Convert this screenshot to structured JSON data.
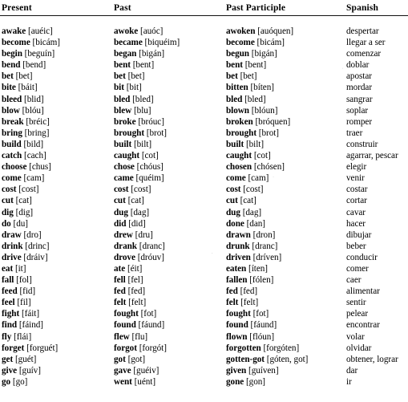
{
  "document": {
    "type": "irregular-verbs-table",
    "headers": {
      "present": "Present",
      "past": "Past",
      "past_participle": "Past Participle",
      "spanish": "Spanish"
    }
  },
  "rows": [
    {
      "present": "awake",
      "present_pron": "[auéic]",
      "past": "awoke",
      "past_pron": "[auóc]",
      "pp": "awoken",
      "pp_pron": "[auóquen]",
      "spanish": "despertar"
    },
    {
      "present": "become",
      "present_pron": "[bicám]",
      "past": "became",
      "past_pron": "[biquéim]",
      "pp": "become",
      "pp_pron": "[bicám]",
      "spanish": "llegar a ser"
    },
    {
      "present": "begin",
      "present_pron": "[beguín]",
      "past": "began",
      "past_pron": "[bigán]",
      "pp": "begun",
      "pp_pron": "[bigán]",
      "spanish": "comenzar"
    },
    {
      "present": "bend",
      "present_pron": "[bend]",
      "past": "bent",
      "past_pron": "[bent]",
      "pp": "bent",
      "pp_pron": "[bent]",
      "spanish": "doblar"
    },
    {
      "present": "bet",
      "present_pron": "[bet]",
      "past": "bet",
      "past_pron": "[bet]",
      "pp": "bet",
      "pp_pron": "[bet]",
      "spanish": "apostar"
    },
    {
      "present": "bite",
      "present_pron": "[báit]",
      "past": "bit",
      "past_pron": "[bit]",
      "pp": "bitten",
      "pp_pron": "[bíten]",
      "spanish": "mordar"
    },
    {
      "present": "bleed",
      "present_pron": "[blid]",
      "past": "bled",
      "past_pron": "[bled]",
      "pp": "bled",
      "pp_pron": "[bled]",
      "spanish": "sangrar"
    },
    {
      "present": "blow",
      "present_pron": "[blóu]",
      "past": "blew",
      "past_pron": "[blu]",
      "pp": "blown",
      "pp_pron": "[blóun]",
      "spanish": "soplar"
    },
    {
      "present": "break",
      "present_pron": "[bréic]",
      "past": "broke",
      "past_pron": "[bróuc]",
      "pp": "broken",
      "pp_pron": "[bróquen]",
      "spanish": "romper"
    },
    {
      "present": "bring",
      "present_pron": "[bring]",
      "past": "brought",
      "past_pron": "[brot]",
      "pp": "brought",
      "pp_pron": "[brot]",
      "spanish": "traer"
    },
    {
      "present": "build",
      "present_pron": "[bild]",
      "past": "built",
      "past_pron": "[bilt]",
      "pp": "built",
      "pp_pron": "[bilt]",
      "spanish": "construir"
    },
    {
      "present": "catch",
      "present_pron": "[cach]",
      "past": "caught",
      "past_pron": "[cot]",
      "pp": "caught",
      "pp_pron": "[cot]",
      "spanish": "agarrar, pescar"
    },
    {
      "present": "choose",
      "present_pron": "[chus]",
      "past": "chose",
      "past_pron": "[chóus]",
      "pp": "chosen",
      "pp_pron": "[chósen]",
      "spanish": "elegir"
    },
    {
      "present": "come",
      "present_pron": "[cam]",
      "past": "came",
      "past_pron": "[quéim]",
      "pp": "come",
      "pp_pron": "[cam]",
      "spanish": "venir"
    },
    {
      "present": "cost",
      "present_pron": "[cost]",
      "past": "cost",
      "past_pron": "[cost]",
      "pp": "cost",
      "pp_pron": "[cost]",
      "spanish": "costar"
    },
    {
      "present": "cut",
      "present_pron": "[cat]",
      "past": "cut",
      "past_pron": "[cat]",
      "pp": "cut",
      "pp_pron": "[cat]",
      "spanish": "cortar"
    },
    {
      "present": "dig",
      "present_pron": "[dig]",
      "past": "dug",
      "past_pron": "[dag]",
      "pp": "dug",
      "pp_pron": "[dag]",
      "spanish": "cavar"
    },
    {
      "present": "do",
      "present_pron": "[du]",
      "past": "did",
      "past_pron": "[did]",
      "pp": "done",
      "pp_pron": "[dan]",
      "spanish": "hacer"
    },
    {
      "present": "draw",
      "present_pron": "[dro]",
      "past": "drew",
      "past_pron": "[dru]",
      "pp": "drawn",
      "pp_pron": "[dron]",
      "spanish": "dibujar"
    },
    {
      "present": "drink",
      "present_pron": "[drinc]",
      "past": "drank",
      "past_pron": "[dranc]",
      "pp": "drunk",
      "pp_pron": "[dranc]",
      "spanish": "beber"
    },
    {
      "present": "drive",
      "present_pron": "[dráiv]",
      "past": "drove",
      "past_pron": "[dróuv]",
      "pp": "driven",
      "pp_pron": "[dríven]",
      "spanish": "conducir"
    },
    {
      "present": "eat",
      "present_pron": "[it]",
      "past": "ate",
      "past_pron": "[éit]",
      "pp": "eaten",
      "pp_pron": "[íten]",
      "spanish": "comer"
    },
    {
      "present": "fall",
      "present_pron": "[fol]",
      "past": "fell",
      "past_pron": "[fel]",
      "pp": "fallen",
      "pp_pron": "[fólen]",
      "spanish": "caer"
    },
    {
      "present": "feed",
      "present_pron": "[fid]",
      "past": "fed",
      "past_pron": "[fed]",
      "pp": "fed",
      "pp_pron": "[fed]",
      "spanish": "alimentar"
    },
    {
      "present": "feel",
      "present_pron": "[fil]",
      "past": "felt",
      "past_pron": "[felt]",
      "pp": "felt",
      "pp_pron": "[felt]",
      "spanish": "sentir"
    },
    {
      "present": "fight",
      "present_pron": "[fáit]",
      "past": "fought",
      "past_pron": "[fot]",
      "pp": "fought",
      "pp_pron": "[fot]",
      "spanish": "pelear"
    },
    {
      "present": "find",
      "present_pron": "[fáind]",
      "past": "found",
      "past_pron": "[fáund]",
      "pp": "found",
      "pp_pron": "[fáund]",
      "spanish": "encontrar"
    },
    {
      "present": "fly",
      "present_pron": "[flái]",
      "past": "flew",
      "past_pron": "[flu]",
      "pp": "flown",
      "pp_pron": "[flóun]",
      "spanish": "volar"
    },
    {
      "present": "forget",
      "present_pron": "[forguét]",
      "past": "forgot",
      "past_pron": "[forgót]",
      "pp": "forgotten",
      "pp_pron": "[forgóten]",
      "spanish": "olvidar"
    },
    {
      "present": "get",
      "present_pron": "[guét]",
      "past": "got",
      "past_pron": "[got]",
      "pp": "gotten-got",
      "pp_pron": "[góten, got]",
      "spanish": "obtener, lograr"
    },
    {
      "present": "give",
      "present_pron": "[guív]",
      "past": "gave",
      "past_pron": "[guéiv]",
      "pp": "given",
      "pp_pron": "[guíven]",
      "spanish": "dar"
    },
    {
      "present": "go",
      "present_pron": "[go]",
      "past": "went",
      "past_pron": "[uént]",
      "pp": "gone",
      "pp_pron": "[gon]",
      "spanish": "ir"
    }
  ]
}
